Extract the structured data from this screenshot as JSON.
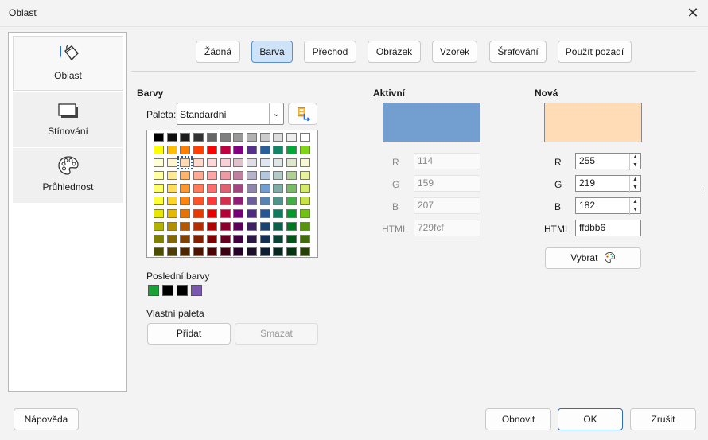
{
  "window": {
    "title": "Oblast",
    "close_glyph": "✕"
  },
  "sidebar": {
    "items": [
      {
        "label": "Oblast",
        "icon": "area-fill-icon"
      },
      {
        "label": "Stínování",
        "icon": "shadow-icon"
      },
      {
        "label": "Průhlednost",
        "icon": "palette-transparency-icon"
      }
    ]
  },
  "tabs": {
    "none": "Žádná",
    "color": "Barva",
    "gradient": "Přechod",
    "image": "Obrázek",
    "pattern": "Vzorek",
    "hatch": "Šrafování",
    "use_background": "Použít pozadí"
  },
  "colors": {
    "heading": "Barvy",
    "palette_label": "Paleta:",
    "palette_value": "Standardní",
    "recent_label": "Poslední barvy",
    "recent": [
      "#1aa236",
      "#000000",
      "#000000",
      "#7b59b1"
    ],
    "custom_label": "Vlastní paleta",
    "add": "Přidat",
    "delete": "Smazat",
    "grid": [
      [
        "#000000",
        "#111111",
        "#1c1c1c",
        "#333333",
        "#666666",
        "#808080",
        "#999999",
        "#b2b2b2",
        "#cccccc",
        "#dddddd",
        "#eeeeee",
        "#ffffff"
      ],
      [
        "#ffff00",
        "#ffbf00",
        "#ff8000",
        "#ff4000",
        "#ff0000",
        "#bf0041",
        "#800080",
        "#55308d",
        "#2a6099",
        "#158466",
        "#00a933",
        "#81d41a"
      ],
      [
        "#ffffd7",
        "#fff5ce",
        "#ffdbb6",
        "#ffd8ce",
        "#ffd7d7",
        "#f7d1d5",
        "#e0c2cd",
        "#dedce6",
        "#dee6ef",
        "#dee7e5",
        "#dde8cb",
        "#f6f9d4"
      ],
      [
        "#ffffa6",
        "#ffe994",
        "#ffb66c",
        "#ffaa95",
        "#ffa6a6",
        "#ec9ba4",
        "#bf819e",
        "#b7b3ca",
        "#b4c7dc",
        "#b3cac7",
        "#afd095",
        "#e8f2a1"
      ],
      [
        "#ffff6d",
        "#ffde59",
        "#ff972f",
        "#ff7b59",
        "#ff6d6d",
        "#e16173",
        "#a1467e",
        "#8e86ae",
        "#729fcf",
        "#81aca6",
        "#77bc65",
        "#d4ea6b"
      ],
      [
        "#ffff38",
        "#ffd428",
        "#ff860d",
        "#ff5429",
        "#ff3838",
        "#d62e4e",
        "#8d1d75",
        "#6b5e9b",
        "#5983b0",
        "#50938a",
        "#3faf46",
        "#c9e24a"
      ],
      [
        "#e6e600",
        "#e6b800",
        "#e67300",
        "#e63900",
        "#e60000",
        "#b30039",
        "#730073",
        "#4d2b80",
        "#255890",
        "#12785e",
        "#009929",
        "#72bf15"
      ],
      [
        "#b2b200",
        "#b28f00",
        "#b25900",
        "#b22d00",
        "#b20000",
        "#8b002c",
        "#590059",
        "#3c2163",
        "#1c426f",
        "#0e5e49",
        "#007721",
        "#599410"
      ],
      [
        "#808000",
        "#806600",
        "#804000",
        "#802000",
        "#800000",
        "#640020",
        "#400040",
        "#2b1847",
        "#143050",
        "#0a4334",
        "#005517",
        "#406a0b"
      ],
      [
        "#4d4d00",
        "#4d3d00",
        "#4d2600",
        "#4d1300",
        "#4d0000",
        "#3c0013",
        "#260026",
        "#1a0e2a",
        "#0c1d30",
        "#06281f",
        "#00330e",
        "#263f07"
      ]
    ],
    "selected": [
      2,
      2
    ]
  },
  "active": {
    "heading": "Aktivní",
    "color": "#729fcf",
    "r_label": "R",
    "r": "114",
    "g_label": "G",
    "g": "159",
    "b_label": "B",
    "b": "207",
    "html_label": "HTML",
    "html": "729fcf"
  },
  "new": {
    "heading": "Nová",
    "color": "#ffdbb6",
    "r_label": "R",
    "r": "255",
    "g_label": "G",
    "g": "219",
    "b_label": "B",
    "b": "182",
    "html_label": "HTML",
    "html": "ffdbb6",
    "pick": "Vybrat"
  },
  "footer": {
    "help": "Nápověda",
    "reset": "Obnovit",
    "ok": "OK",
    "cancel": "Zrušit"
  }
}
